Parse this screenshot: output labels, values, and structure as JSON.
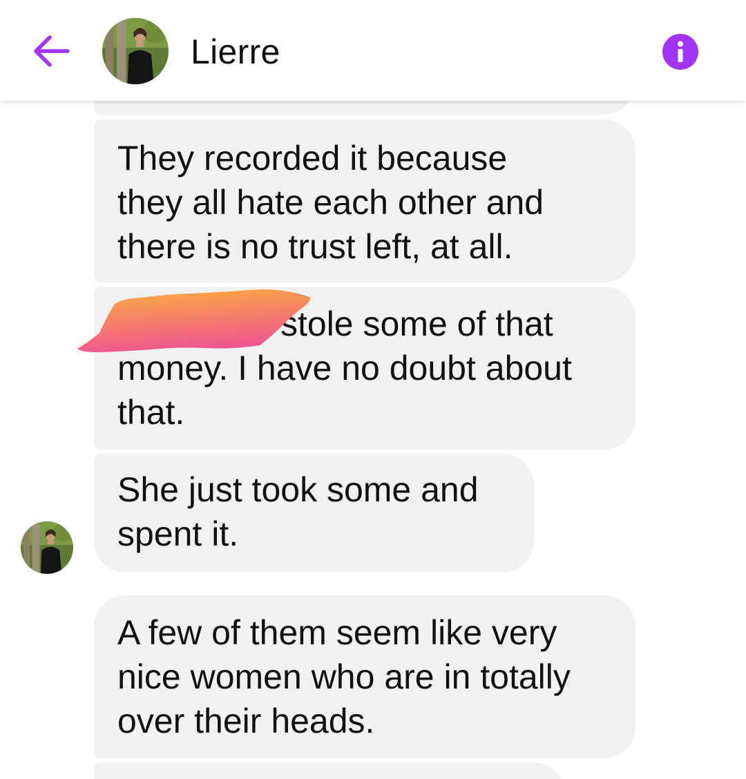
{
  "header": {
    "contact_name": "Lierre",
    "back_icon": "arrow-left-icon",
    "info_icon": "info-icon",
    "accent_color": "#a333f5"
  },
  "messages": [
    {
      "text": "They recorded it because\nthey all hate each other and\nthere is no trust left, at all."
    },
    {
      "text": "stole some of that\nmoney. I have no doubt about\nthat.",
      "redacted_prefix": true
    },
    {
      "text": "She just took some and\nspent it."
    },
    {
      "text": "A few of them seem like very\nnice women who are in totally\nover their heads."
    }
  ],
  "colors": {
    "bubble_bg": "#f1f1f1",
    "text": "#111111",
    "redaction_gradient": [
      "#fbb03b",
      "#f0568f"
    ]
  }
}
